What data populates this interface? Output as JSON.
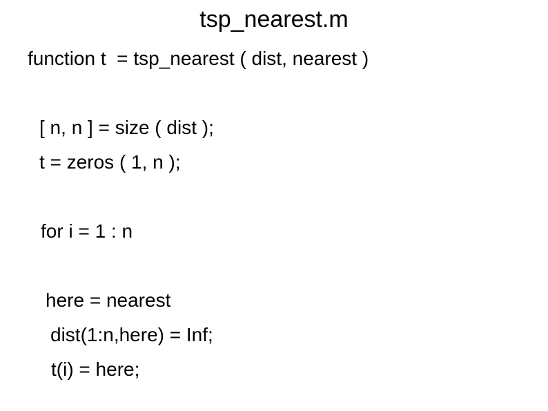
{
  "slide": {
    "title": "tsp_nearest.m",
    "background_color": "#ffffff",
    "text_color": "#000000",
    "code_lines": [
      {
        "text": "function t  = tsp_nearest ( dist, nearest )"
      },
      {
        "text": "[ n, n ] = size ( dist );"
      },
      {
        "text": "t = zeros ( 1, n );"
      },
      {
        "text": "for i = 1 : n"
      },
      {
        "text": "here = nearest"
      },
      {
        "text": "dist(1:n,here) = Inf;"
      },
      {
        "text": "t(i) = here;"
      }
    ]
  }
}
